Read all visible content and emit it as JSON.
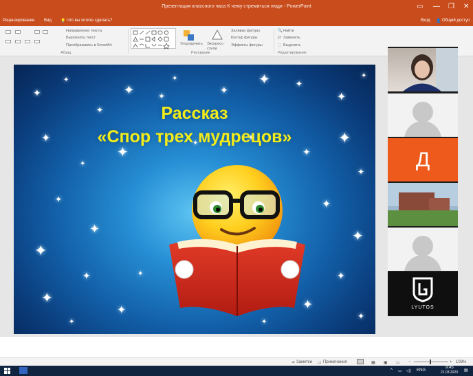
{
  "window": {
    "title": "Презентация классного часа К чему стремиться люди - PowerPoint",
    "controls": [
      "▭",
      "—",
      "❐",
      "✕"
    ]
  },
  "tabs": {
    "items": [
      "Рецензирование",
      "Вид",
      "Что вы хотите сделать?"
    ],
    "sign_in": "Вход",
    "share": "Общий доступ"
  },
  "ribbon": {
    "paragraph": {
      "text_direction": "Направление текста",
      "align_text": "Выровнять текст",
      "convert_smartart": "Преобразовать в SmartArt",
      "group_label": "Абзац"
    },
    "drawing": {
      "arrange": "Упорядочить",
      "quick_styles": "Экспресс-стили",
      "fill": "Заливка фигуры",
      "outline": "Контур фигуры",
      "effects": "Эффекты фигуры",
      "group_label": "Рисование"
    },
    "editing": {
      "find": "Найти",
      "replace": "Заменить",
      "select": "Выделить",
      "group_label": "Редактирование"
    }
  },
  "slide": {
    "title_line1": "Рассказ",
    "title_line2": "«Спор трех мудрецов»"
  },
  "video": {
    "letter_tile": "Д",
    "letter_color": "#ee5a1c",
    "logo_text": "LYUTOS"
  },
  "statusbar": {
    "notes": "Заметки",
    "comments": "Примечания",
    "zoom": "108%"
  },
  "taskbar": {
    "lang": "ENG",
    "time": "9:45",
    "date": "21.03.2020"
  },
  "colors": {
    "accent": "#c94c1c",
    "slide_title": "#f3ec1a"
  }
}
